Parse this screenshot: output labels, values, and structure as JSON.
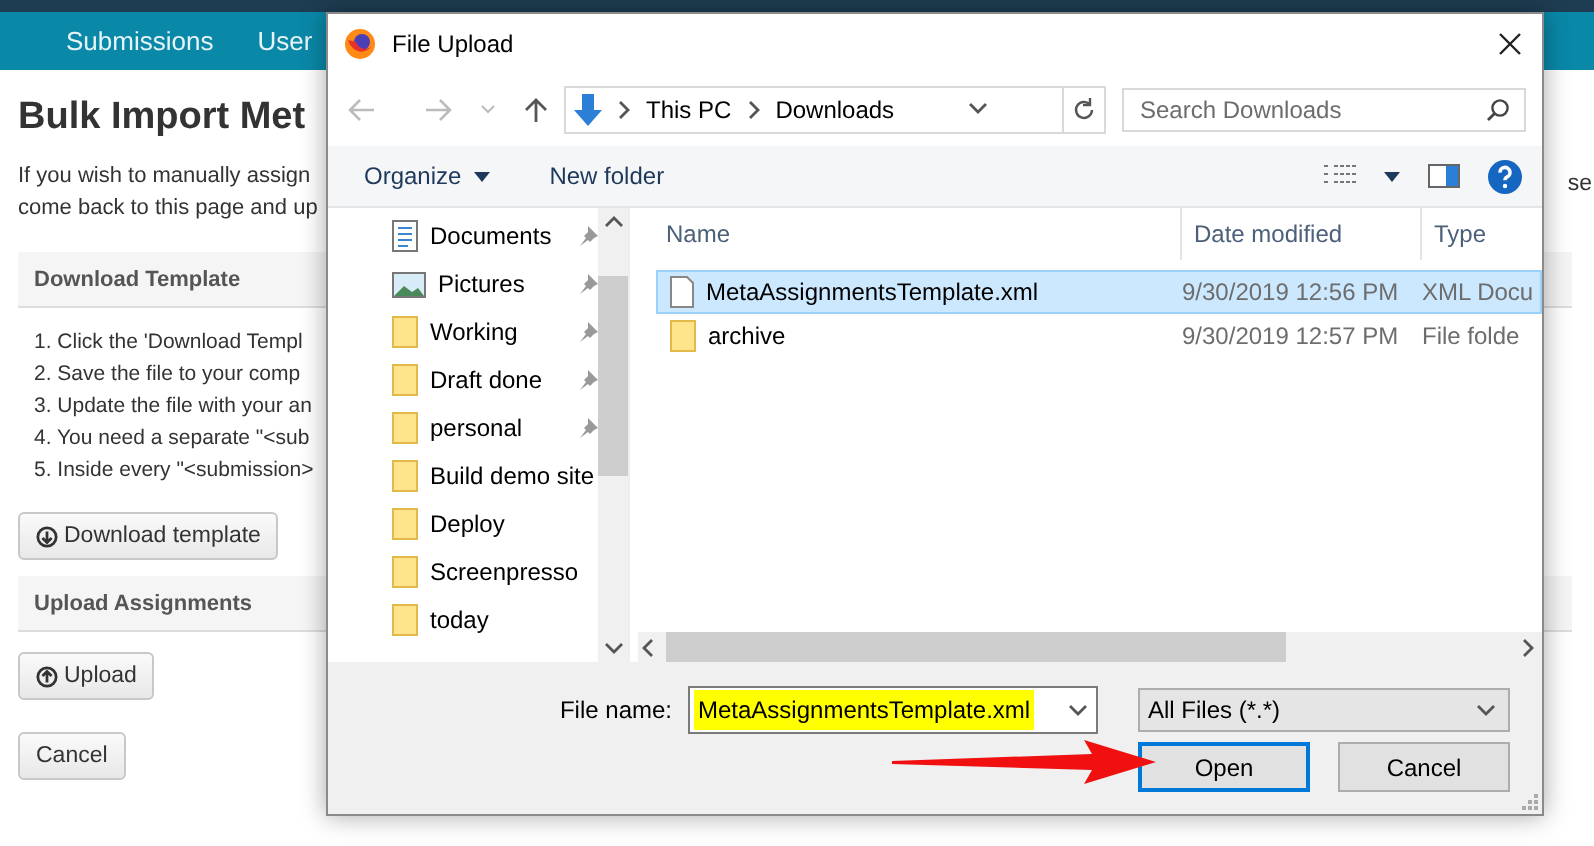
{
  "app_nav": {
    "items": [
      {
        "label": "Submissions"
      },
      {
        "label": "User"
      }
    ]
  },
  "page": {
    "title": "Bulk Import Met",
    "intro": [
      "If you wish to manually assign",
      "come back to this page and up"
    ],
    "intro_tail": "se",
    "sections": [
      {
        "heading": "Download Template",
        "steps": [
          "1. Click the 'Download Templ",
          "2. Save the file to your comp",
          "3. Update the file with your an",
          "4. You need a separate \"<sub",
          "5. Inside every \"<submission>"
        ],
        "button": "Download template"
      },
      {
        "heading": "Upload Assignments",
        "button": "Upload"
      }
    ],
    "cancel": "Cancel"
  },
  "dialog": {
    "title": "File Upload",
    "breadcrumb": [
      "This PC",
      "Downloads"
    ],
    "search": {
      "placeholder": "Search Downloads"
    },
    "toolbar": [
      "Organize",
      "New folder"
    ],
    "nav_items": [
      {
        "label": "Documents",
        "kind": "documents",
        "pinned": true
      },
      {
        "label": "Pictures",
        "kind": "pictures",
        "pinned": true
      },
      {
        "label": "Working",
        "kind": "folder",
        "pinned": true
      },
      {
        "label": "Draft done",
        "kind": "folder",
        "pinned": true
      },
      {
        "label": "personal",
        "kind": "folder",
        "pinned": true
      },
      {
        "label": "Build demo site",
        "kind": "folder",
        "pinned": false
      },
      {
        "label": "Deploy",
        "kind": "folder",
        "pinned": false
      },
      {
        "label": "Screenpresso",
        "kind": "folder",
        "pinned": false
      },
      {
        "label": "today",
        "kind": "folder",
        "pinned": false
      }
    ],
    "columns": [
      "Name",
      "Date modified",
      "Type"
    ],
    "files": [
      {
        "name": "MetaAssignmentsTemplate.xml",
        "kind": "file",
        "date": "9/30/2019 12:56 PM",
        "type": "XML Docu",
        "selected": true
      },
      {
        "name": "archive",
        "kind": "folder",
        "date": "9/30/2019 12:57 PM",
        "type": "File folde",
        "selected": false
      }
    ],
    "file_name_label": "File name:",
    "file_name": "MetaAssignmentsTemplate.xml",
    "file_type": "All Files (*.*)",
    "buttons": [
      {
        "label": "Open",
        "default": true
      },
      {
        "label": "Cancel",
        "default": false
      }
    ]
  }
}
